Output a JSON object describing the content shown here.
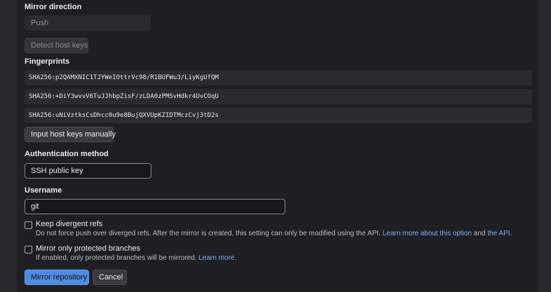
{
  "mirror_direction": {
    "label": "Mirror direction",
    "value": "Push"
  },
  "detect_host_keys_label": "Detect host keys",
  "fingerprints": {
    "label": "Fingerprints",
    "items": [
      "SHA256:p2QAMXNIC1TJYWeIOttrVc98/R1BUFWu3/LiyKgUfQM",
      "SHA256:+DiY3wvvV6TuJJhbpZisF/zLDA0zPMSvHdkr4UvCOqU",
      "SHA256:uNiVztksCsDhcc0u9e8BujQXVUpKZIDTMczCvj3tD2s"
    ]
  },
  "input_host_keys_label": "Input host keys manually",
  "auth_method": {
    "label": "Authentication method",
    "value": "SSH public key"
  },
  "username": {
    "label": "Username",
    "value": "git"
  },
  "keep_divergent": {
    "label": "Keep divergent refs",
    "help_text": "Do not force push over diverged refs. After the mirror is created, this setting can only be modified using the API.",
    "link_option": "Learn more about this option",
    "and": "and",
    "link_api": "the API."
  },
  "protected_only": {
    "label": "Mirror only protected branches",
    "help_text": "If enabled, only protected branches will be mirrored.",
    "link": "Learn more."
  },
  "actions": {
    "submit_label": "Mirror repository",
    "cancel_label": "Cancel"
  },
  "colors": {
    "background": "#1f1e24",
    "field_disabled": "#2b2a30",
    "primary_button": "#4f8ce0",
    "link": "#7cb3f2"
  }
}
